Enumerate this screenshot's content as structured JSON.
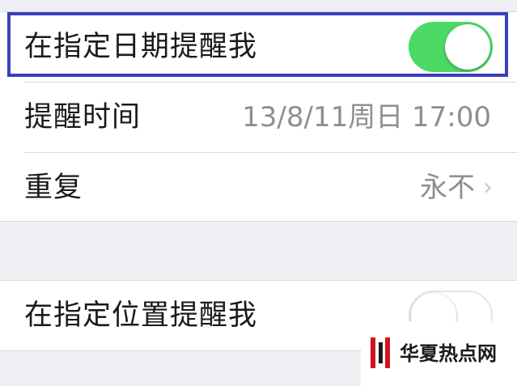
{
  "settings": {
    "date_reminder": {
      "label": "在指定日期提醒我",
      "enabled": true
    },
    "reminder_time": {
      "label": "提醒时间",
      "value": "13/8/11周日 17:00"
    },
    "repeat": {
      "label": "重复",
      "value": "永不"
    },
    "location_reminder": {
      "label": "在指定位置提醒我",
      "enabled": false
    }
  },
  "watermark": {
    "text": "华夏热点网"
  },
  "colors": {
    "toggle_on": "#4cd964",
    "highlight_border": "#3a3fbf",
    "watermark_red": "#d0141c"
  }
}
